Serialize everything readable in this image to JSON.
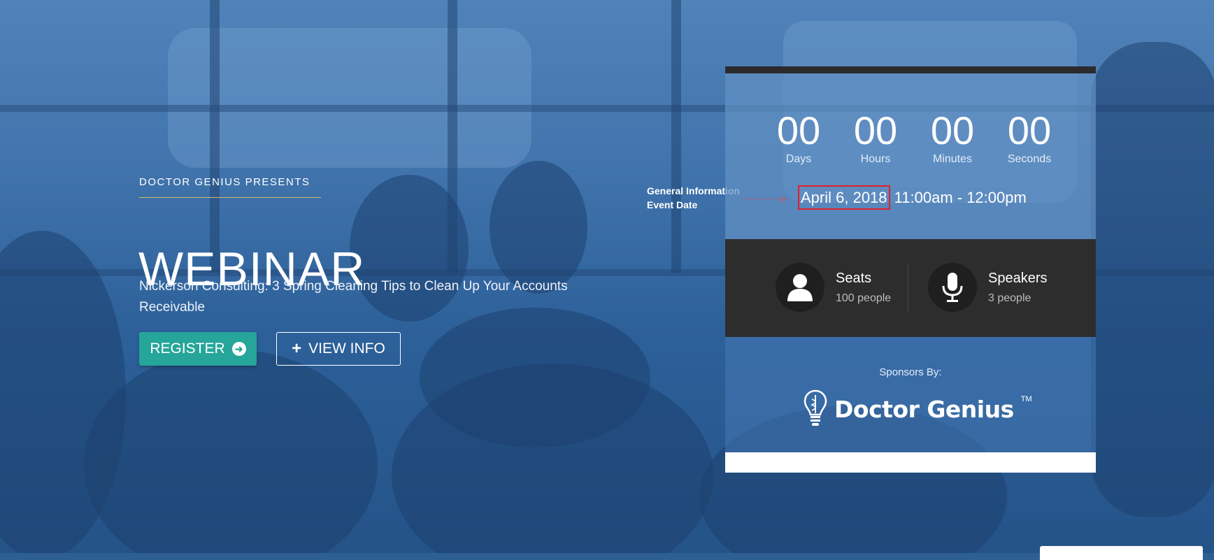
{
  "hero": {
    "presents": "DOCTOR GENIUS PRESENTS",
    "title": "WEBINAR",
    "subtitle": "Nickerson Consulting: 3 Spring Cleaning Tips to Clean Up Your Accounts Receivable",
    "register_label": "REGISTER",
    "view_info_label": "VIEW INFO"
  },
  "countdown": [
    {
      "value": "00",
      "label": "Days"
    },
    {
      "value": "00",
      "label": "Hours"
    },
    {
      "value": "00",
      "label": "Minutes"
    },
    {
      "value": "00",
      "label": "Seconds"
    }
  ],
  "event": {
    "date": "April 6, 2018",
    "time": "11:00am - 12:00pm"
  },
  "annotation": {
    "line1": "General Information",
    "line2": "Event Date"
  },
  "stats": {
    "seats": {
      "title": "Seats",
      "value": "100 people"
    },
    "speakers": {
      "title": "Speakers",
      "value": "3 people"
    }
  },
  "sponsors": {
    "label": "Sponsors By:",
    "logo_text": "Doctor Genius",
    "logo_tm": "TM"
  },
  "colors": {
    "accent": "#26a59a",
    "annotation": "#e0202a",
    "panel_dark": "#2d2d2d"
  }
}
